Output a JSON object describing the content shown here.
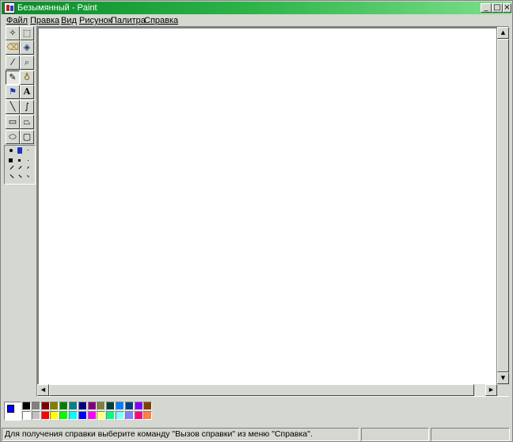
{
  "window": {
    "title": "Безымянный - Paint",
    "minimize_glyph": "_",
    "maximize_glyph": "□",
    "close_glyph": "×"
  },
  "menu": [
    {
      "label": "Файл"
    },
    {
      "label": "Правка"
    },
    {
      "label": "Вид"
    },
    {
      "label": "Рисунок"
    },
    {
      "label": "Палитра"
    },
    {
      "label": "Справка"
    }
  ],
  "tools": [
    {
      "name": "free-form-select-icon",
      "glyph": "✧"
    },
    {
      "name": "rect-select-icon",
      "glyph": "⬚"
    },
    {
      "name": "eraser-icon",
      "glyph": "⌫"
    },
    {
      "name": "fill-bucket-icon",
      "glyph": "◈"
    },
    {
      "name": "color-picker-icon",
      "glyph": "⁄"
    },
    {
      "name": "magnifier-icon",
      "glyph": "⌕"
    },
    {
      "name": "pencil-icon",
      "glyph": "✎"
    },
    {
      "name": "brush-icon",
      "glyph": "♁"
    },
    {
      "name": "airbrush-icon",
      "glyph": "⚑"
    },
    {
      "name": "text-icon",
      "glyph": "A"
    },
    {
      "name": "line-icon",
      "glyph": "╲"
    },
    {
      "name": "curve-icon",
      "glyph": "∫"
    },
    {
      "name": "rectangle-icon",
      "glyph": "▭"
    },
    {
      "name": "polygon-icon",
      "glyph": "⏢"
    },
    {
      "name": "ellipse-icon",
      "glyph": "⬭"
    },
    {
      "name": "rounded-rect-icon",
      "glyph": "▢"
    }
  ],
  "scrollbar": {
    "up_glyph": "▲",
    "down_glyph": "▼",
    "left_glyph": "◀",
    "right_glyph": "▶"
  },
  "palette": {
    "foreground": "#0000ff",
    "background": "#00ff00",
    "row1": [
      "#000000",
      "#808080",
      "#800000",
      "#808000",
      "#008000",
      "#008080",
      "#000080",
      "#800080",
      "#808040",
      "#004040",
      "#0080ff",
      "#004080",
      "#8000ff",
      "#804000"
    ],
    "row2": [
      "#ffffff",
      "#c0c0c0",
      "#ff0000",
      "#ffff00",
      "#00ff00",
      "#00ffff",
      "#0000ff",
      "#ff00ff",
      "#ffff80",
      "#00ff80",
      "#80ffff",
      "#8080ff",
      "#ff0080",
      "#ff8040"
    ]
  },
  "status": {
    "help_text": "Для получения справки выберите команду \"Вызов справки\" из меню \"Справка\"."
  }
}
